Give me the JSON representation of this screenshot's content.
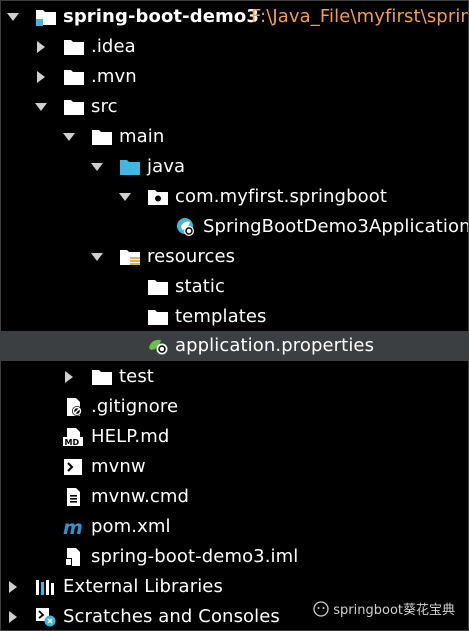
{
  "project": {
    "name": "spring-boot-demo3",
    "path": "F:\\Java_File\\myfirst\\spring"
  },
  "tree": {
    "idea": ".idea",
    "mvn": ".mvn",
    "src": "src",
    "main": "main",
    "java": "java",
    "package": "com.myfirst.springboot",
    "app_class": "SpringBootDemo3Application",
    "resources": "resources",
    "static": "static",
    "templates": "templates",
    "properties": "application.properties",
    "test": "test",
    "gitignore": ".gitignore",
    "help": "HELP.md",
    "mvnw": "mvnw",
    "mvnw_cmd": "mvnw.cmd",
    "pom": "pom.xml",
    "iml": "spring-boot-demo3.iml",
    "external_libraries": "External Libraries",
    "scratches": "Scratches and Consoles"
  },
  "watermark": {
    "text": "springboot葵花宝典"
  },
  "colors": {
    "background": "#000000",
    "selected_row": "#3c3f41",
    "path_text": "#f0a050",
    "java_folder": "#40b6e0",
    "spring_green": "#6cbf4a",
    "maven_blue": "#3592c4"
  },
  "icons": {
    "module": "module-folder-icon",
    "folder": "folder-icon",
    "source_folder": "source-folder-icon",
    "package": "package-icon",
    "spring_class": "spring-boot-class-icon",
    "resources_folder": "resources-folder-icon",
    "properties": "spring-properties-icon",
    "ignore": "ignore-file-icon",
    "markdown": "markdown-file-icon",
    "shell": "shell-script-icon",
    "text_file": "text-file-icon",
    "maven": "maven-icon",
    "iml": "iml-file-icon",
    "libraries": "libraries-icon",
    "scratches": "scratches-icon"
  }
}
